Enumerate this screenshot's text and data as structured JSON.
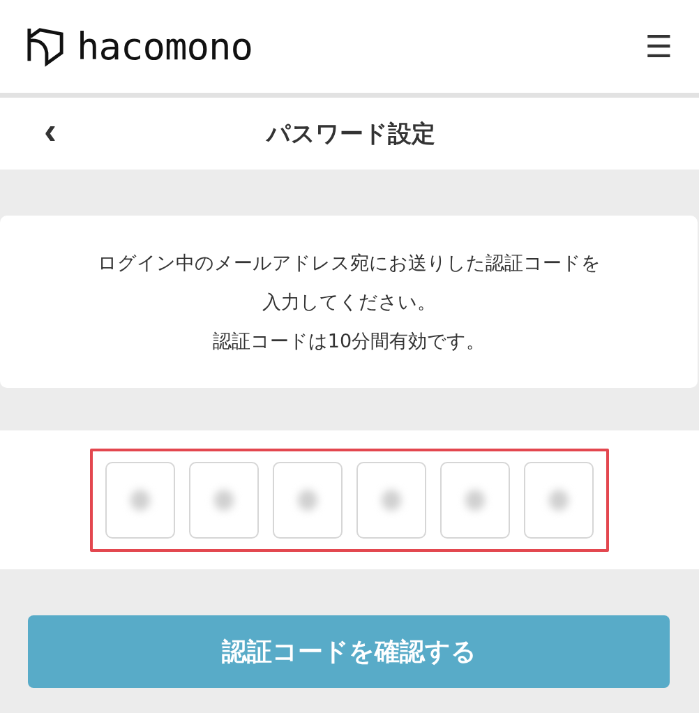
{
  "header": {
    "logo_text": "hacomono",
    "menu_icon": "☰"
  },
  "title_bar": {
    "back": "‹",
    "title": "パスワード設定"
  },
  "message": {
    "lines": [
      "ログイン中のメールアドレス宛にお送りした認証コードを",
      "入力してください。",
      "認証コードは10分間有効です。"
    ]
  },
  "code_input": {
    "highlighted": true,
    "boxes": [
      {
        "filled": true
      },
      {
        "filled": true
      },
      {
        "filled": true
      },
      {
        "filled": true
      },
      {
        "filled": true
      },
      {
        "filled": true
      }
    ]
  },
  "submit_button": {
    "label": "認証コードを確認する"
  }
}
